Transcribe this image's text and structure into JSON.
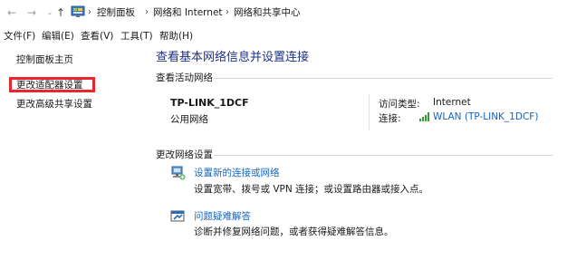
{
  "address_bar": {
    "back_icon": "arrow-left-icon",
    "forward_icon": "arrow-right-icon",
    "up_icon": "arrow-up-icon",
    "breadcrumbs": [
      "控制面板",
      "网络和 Internet",
      "网络和共享中心"
    ]
  },
  "menu": [
    "文件(F)",
    "编辑(E)",
    "查看(V)",
    "工具(T)",
    "帮助(H)"
  ],
  "sidebar": {
    "items": [
      {
        "label": "控制面板主页"
      },
      {
        "label": "更改适配器设置",
        "highlighted": true
      },
      {
        "label": "更改高级共享设置"
      }
    ],
    "highlight_color": "#e8262c"
  },
  "main": {
    "title": "查看基本网络信息并设置连接",
    "active_networks": {
      "section_title": "查看活动网络",
      "network_name": "TP-LINK_1DCF",
      "network_type": "公用网络",
      "access_type_label": "访问类型:",
      "access_type_value": "Internet",
      "connection_label": "连接:",
      "connection_value": "WLAN (TP-LINK_1DCF)"
    },
    "change_settings": {
      "section_title": "更改网络设置",
      "tasks": [
        {
          "title": "设置新的连接或网络",
          "desc": "设置宽带、拨号或 VPN 连接；或设置路由器或接入点。",
          "icon": "network-setup-icon"
        },
        {
          "title": "问题疑难解答",
          "desc": "诊断并修复网络问题，或者获得疑难解答信息。",
          "icon": "troubleshoot-icon"
        }
      ]
    }
  },
  "colors": {
    "link": "#1565c0",
    "title": "#1e3287"
  }
}
